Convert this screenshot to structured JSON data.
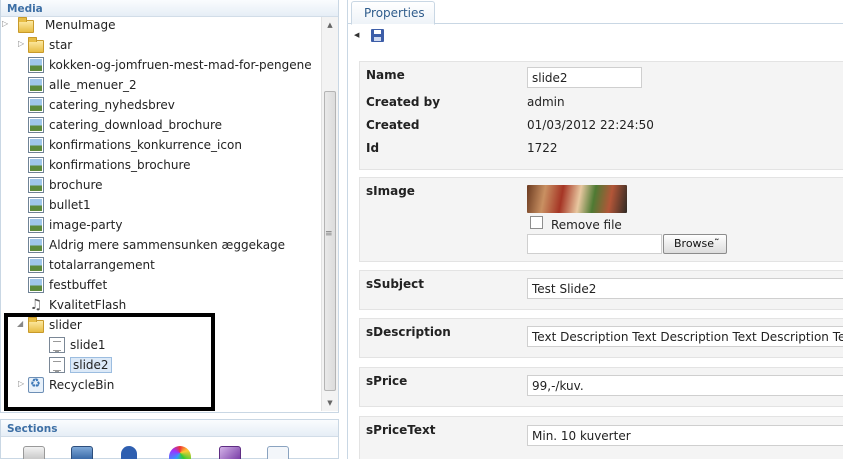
{
  "media_panel": {
    "title": "Media",
    "items": [
      {
        "label": "MenuImage",
        "type": "folder"
      },
      {
        "label": "star",
        "type": "folder"
      },
      {
        "label": "kokken-og-jomfruen-mest-mad-for-pengene",
        "type": "image"
      },
      {
        "label": "alle_menuer_2",
        "type": "image"
      },
      {
        "label": "catering_nyhedsbrev",
        "type": "image"
      },
      {
        "label": "catering_download_brochure",
        "type": "image"
      },
      {
        "label": "konfirmations_konkurrence_icon",
        "type": "image"
      },
      {
        "label": "konfirmations_brochure",
        "type": "image"
      },
      {
        "label": "brochure",
        "type": "image"
      },
      {
        "label": "bullet1",
        "type": "image"
      },
      {
        "label": "image-party",
        "type": "image"
      },
      {
        "label": "Aldrig mere sammensunken æggekage",
        "type": "image"
      },
      {
        "label": "totalarrangement",
        "type": "image"
      },
      {
        "label": "festbuffet",
        "type": "image"
      },
      {
        "label": "KvalitetFlash",
        "type": "flash"
      },
      {
        "label": "slider",
        "type": "folder",
        "expanded": true
      },
      {
        "label": "slide1",
        "type": "document"
      },
      {
        "label": "slide2",
        "type": "document",
        "selected": true
      },
      {
        "label": "RecycleBin",
        "type": "recycle-bin"
      }
    ]
  },
  "sections_panel": {
    "title": "Sections",
    "icons": [
      "edit-icon",
      "monitor-icon",
      "user-icon",
      "color-wheel-icon",
      "brush-icon",
      "form-icon"
    ]
  },
  "properties": {
    "tab_label": "Properties",
    "name_label": "Name",
    "name_value": "slide2",
    "created_by_label": "Created by",
    "created_by_value": "admin",
    "created_label": "Created",
    "created_value": "01/03/2012 22:24:50",
    "id_label": "Id",
    "id_value": "1722",
    "simage_label": "sImage",
    "remove_file_label": "Remove file",
    "browse_label": "Browse˜",
    "ssubject_label": "sSubject",
    "ssubject_value": "Test Slide2",
    "sdescription_label": "sDescription",
    "sdescription_value": "Text Description Text Description Text Description Text",
    "sprice_label": "sPrice",
    "sprice_value": "99,-/kuv.",
    "spricetext_label": "sPriceText",
    "spricetext_value": "Min. 10 kuverter"
  },
  "colors": {
    "panel_border": "#c9d7e4",
    "header_text": "#3d6fa5",
    "selection_bg": "#dce9f7",
    "highlight_frame": "#000000"
  }
}
